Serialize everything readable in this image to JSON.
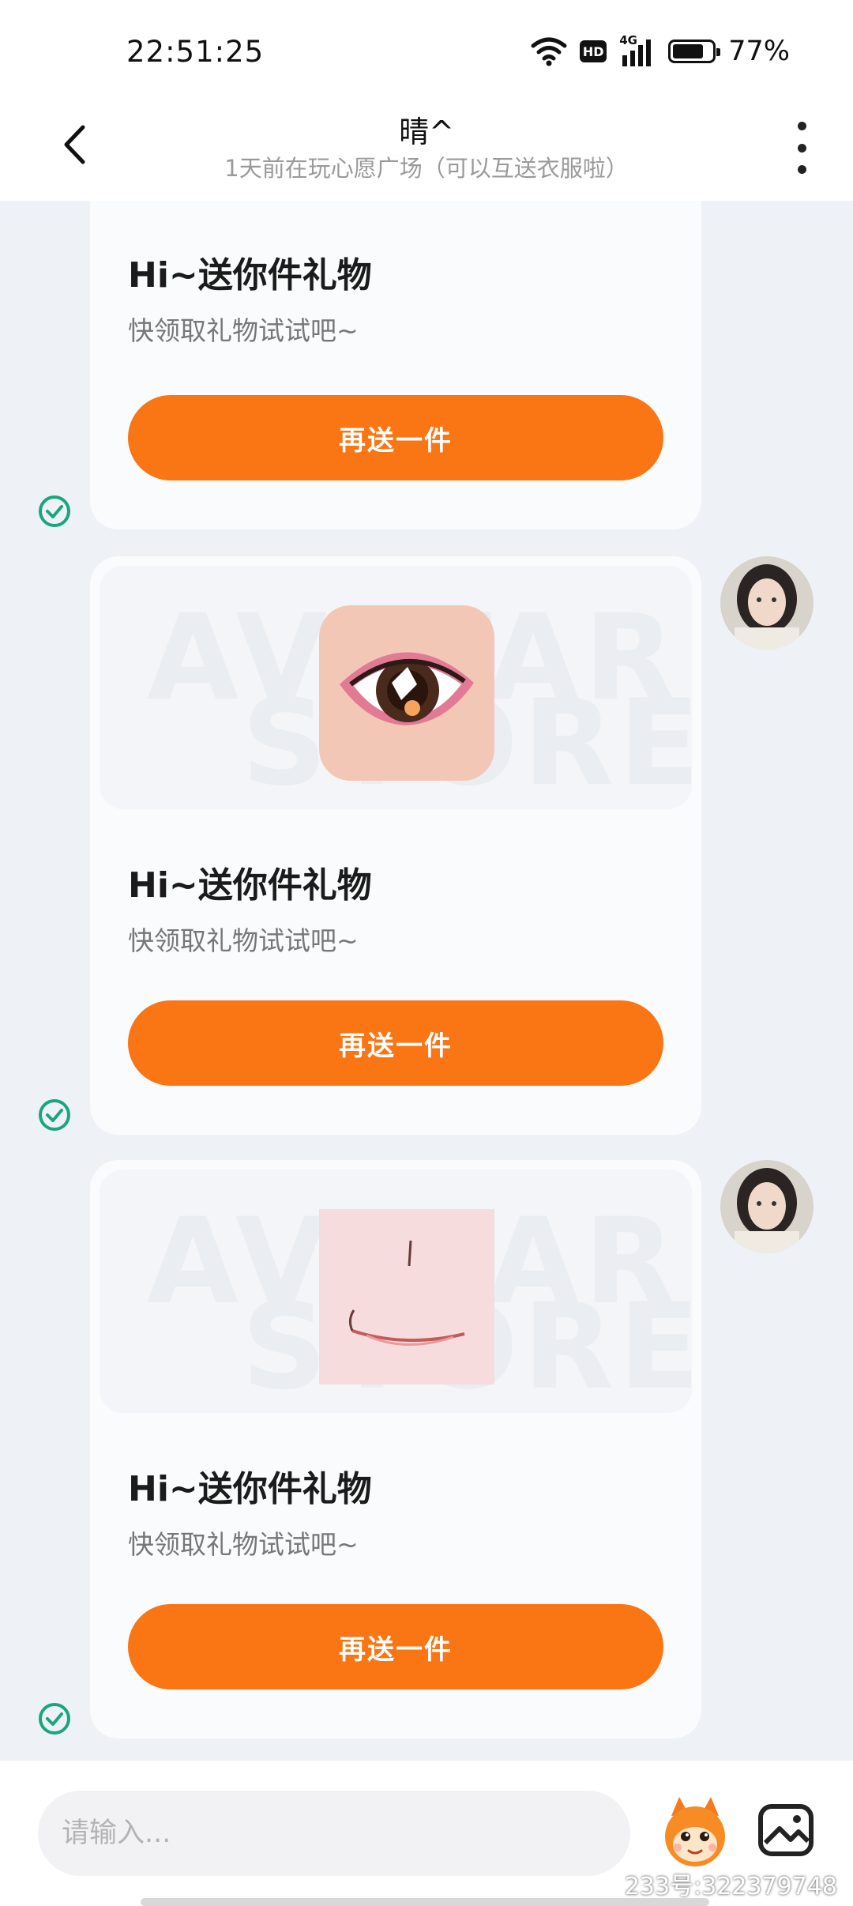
{
  "status_bar": {
    "time": "22:51:25",
    "battery": "77%",
    "network": "4G",
    "hd_badge": "HD"
  },
  "header": {
    "name": "晴^",
    "subtitle": "1天前在玩心愿广场（可以互送衣服啦）"
  },
  "messages": [
    {
      "title": "Hi~送你件礼物",
      "desc": "快领取礼物试试吧~",
      "button": "再送一件"
    },
    {
      "title": "Hi~送你件礼物",
      "desc": "快领取礼物试试吧~",
      "button": "再送一件",
      "image": "eye-gift"
    },
    {
      "title": "Hi~送你件礼物",
      "desc": "快领取礼物试试吧~",
      "button": "再送一件",
      "image": "mouth-gift"
    }
  ],
  "watermark": {
    "line1": "AVATAR",
    "line2": "STORE"
  },
  "input": {
    "placeholder": "请输入..."
  },
  "footer": {
    "account_id": "233号:322379748"
  },
  "colors": {
    "accent": "#fa7514",
    "check": "#18a77a",
    "background": "#eef2f6"
  }
}
